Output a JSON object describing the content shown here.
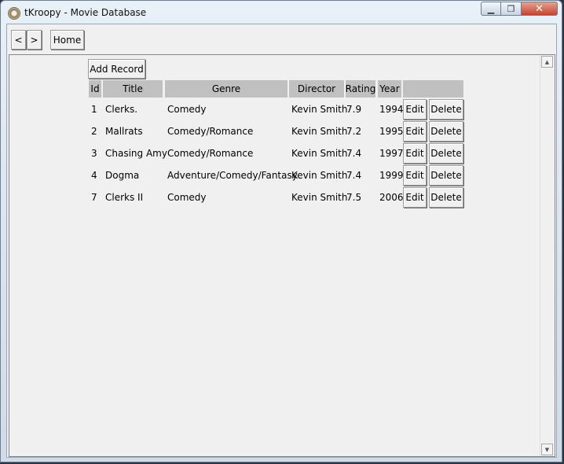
{
  "window": {
    "title": "tKroopy - Movie Database"
  },
  "nav": {
    "back": "<",
    "forward": ">",
    "home": "Home"
  },
  "toolbar": {
    "add_record": "Add Record"
  },
  "table": {
    "columns": [
      "Id",
      "Title",
      "Genre",
      "Director",
      "Rating",
      "Year",
      ""
    ],
    "rows": [
      {
        "id": "1",
        "title": "Clerks.",
        "genre": "Comedy",
        "director": "Kevin Smith",
        "rating": "7.9",
        "year": "1994"
      },
      {
        "id": "2",
        "title": "Mallrats",
        "genre": "Comedy/Romance",
        "director": "Kevin Smith",
        "rating": "7.2",
        "year": "1995"
      },
      {
        "id": "3",
        "title": "Chasing Amy",
        "genre": "Comedy/Romance",
        "director": "Kevin Smith",
        "rating": "7.4",
        "year": "1997"
      },
      {
        "id": "4",
        "title": "Dogma",
        "genre": "Adventure/Comedy/Fantasy",
        "director": "Kevin Smith",
        "rating": "7.4",
        "year": "1999"
      },
      {
        "id": "7",
        "title": "Clerks II",
        "genre": "Comedy",
        "director": "Kevin Smith",
        "rating": "7.5",
        "year": "2006"
      }
    ],
    "edit_label": "Edit",
    "delete_label": "Delete"
  }
}
